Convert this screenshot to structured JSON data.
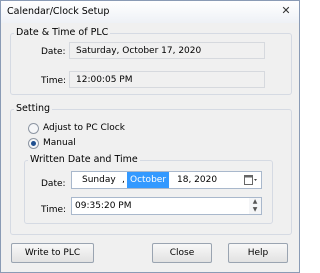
{
  "window": {
    "title": "Calendar/Clock Setup",
    "close_glyph": "✕"
  },
  "plc": {
    "group_label": "Date & Time of PLC",
    "date_label": "Date:",
    "date_value": "Saturday, October 17, 2020",
    "time_label": "Time:",
    "time_value": "12:00:05 PM"
  },
  "setting": {
    "group_label": "Setting",
    "options": [
      {
        "label": "Adjust to PC Clock",
        "checked": false
      },
      {
        "label": "Manual",
        "checked": true
      }
    ],
    "written": {
      "group_label": "Written Date and Time",
      "date_label": "Date:",
      "date_weekday": "Sunday",
      "date_sep": ",",
      "date_month": "October",
      "date_rest": "18, 2020",
      "time_label": "Time:",
      "time_value": "09:35:20 PM"
    }
  },
  "buttons": {
    "write": "Write to PLC",
    "close": "Close",
    "help": "Help"
  }
}
